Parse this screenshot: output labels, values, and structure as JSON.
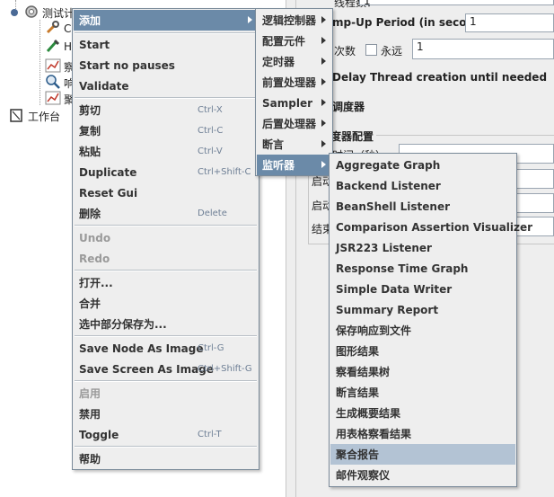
{
  "tree": {
    "test_plan_label": "测试计",
    "items": [
      "C",
      "H",
      "察",
      "响",
      "聚"
    ],
    "workbench_label": "工作台"
  },
  "right_panel": {
    "threads_label": "线程数：",
    "threads_value": "1",
    "rampup_label": "mp-Up Period (in seconds):",
    "rampup_value": "1",
    "loop_label": "次数",
    "forever_label": "永远",
    "loop_value": "1",
    "delay_label": "Delay Thread creation until needed",
    "scheduler_label": "调度器",
    "scheduler_config_label": "度器配置",
    "duration_label": "时间（秒）",
    "startup_label": "启动",
    "start_label": "启动",
    "end_label": "结束"
  },
  "context_menu": {
    "items": [
      {
        "label": "添加",
        "submenu": true,
        "highlighted": true
      },
      {
        "label": "Start"
      },
      {
        "label": "Start no pauses"
      },
      {
        "label": "Validate"
      },
      {
        "label": "剪切",
        "shortcut": "Ctrl-X"
      },
      {
        "label": "复制",
        "shortcut": "Ctrl-C"
      },
      {
        "label": "粘贴",
        "shortcut": "Ctrl-V"
      },
      {
        "label": "Duplicate",
        "shortcut": "Ctrl+Shift-C"
      },
      {
        "label": "Reset Gui"
      },
      {
        "label": "删除",
        "shortcut": "Delete"
      },
      {
        "label": "Undo",
        "disabled": true
      },
      {
        "label": "Redo",
        "disabled": true
      },
      {
        "label": "打开..."
      },
      {
        "label": "合并"
      },
      {
        "label": "选中部分保存为..."
      },
      {
        "label": "Save Node As Image",
        "shortcut": "Ctrl-G"
      },
      {
        "label": "Save Screen As Image",
        "shortcut": "Ctrl+Shift-G"
      },
      {
        "label": "启用",
        "disabled": true
      },
      {
        "label": "禁用"
      },
      {
        "label": "Toggle",
        "shortcut": "Ctrl-T"
      },
      {
        "label": "帮助"
      }
    ]
  },
  "add_submenu": {
    "items": [
      {
        "label": "逻辑控制器",
        "submenu": true
      },
      {
        "label": "配置元件",
        "submenu": true
      },
      {
        "label": "定时器",
        "submenu": true
      },
      {
        "label": "前置处理器",
        "submenu": true
      },
      {
        "label": "Sampler",
        "submenu": true
      },
      {
        "label": "后置处理器",
        "submenu": true
      },
      {
        "label": "断言",
        "submenu": true
      },
      {
        "label": "监听器",
        "submenu": true,
        "highlighted": true
      }
    ]
  },
  "listener_submenu": {
    "items": [
      {
        "label": "Aggregate Graph"
      },
      {
        "label": "Backend Listener"
      },
      {
        "label": "BeanShell Listener"
      },
      {
        "label": "Comparison Assertion Visualizer"
      },
      {
        "label": "JSR223 Listener"
      },
      {
        "label": "Response Time Graph"
      },
      {
        "label": "Simple Data Writer"
      },
      {
        "label": "Summary Report"
      },
      {
        "label": "保存响应到文件"
      },
      {
        "label": "图形结果"
      },
      {
        "label": "察看结果树"
      },
      {
        "label": "断言结果"
      },
      {
        "label": "生成概要结果"
      },
      {
        "label": "用表格察看结果"
      },
      {
        "label": "聚合报告",
        "highlighted": true
      },
      {
        "label": "邮件观察仪"
      }
    ]
  },
  "colors": {
    "menu_bg": "#eeeeee",
    "highlight": "#6b8aa8",
    "hover_light": "#b3c3d4",
    "shortcut": "#6e7f95"
  }
}
